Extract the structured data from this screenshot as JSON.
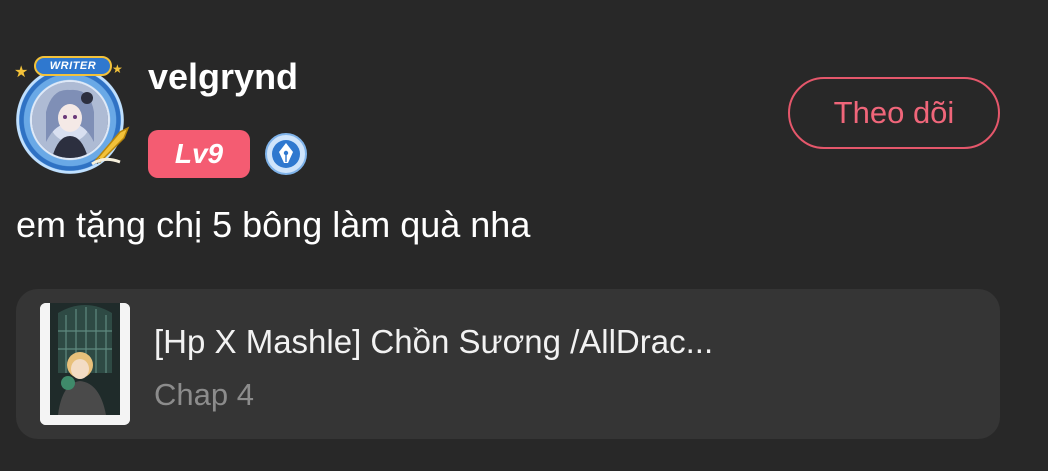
{
  "comment": {
    "author": {
      "username": "velgrynd",
      "avatar_frame_label": "WRITER",
      "level": "Lv9",
      "writer_badge_icon": "pen-nib-icon"
    },
    "follow_button_label": "Theo dõi",
    "text": "em tặng chị 5 bông làm quà nha",
    "story": {
      "title": "[Hp X Mashle] Chồn Sương /AllDrac...",
      "chapter": "Chap 4"
    }
  },
  "colors": {
    "background": "#282828",
    "card": "#353535",
    "accent": "#f45c72",
    "follow_border": "#e5576b",
    "muted_text": "#8c8c8c"
  }
}
